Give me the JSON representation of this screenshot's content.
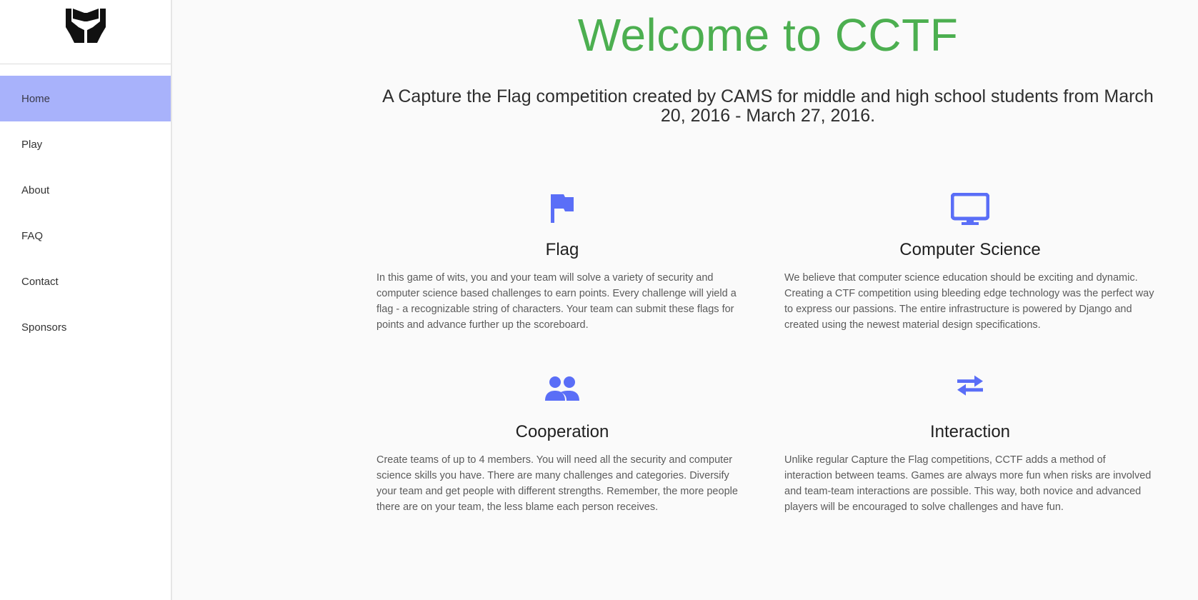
{
  "sidebar": {
    "logo_icon": "hands-holding-icon",
    "items": [
      {
        "label": "Home",
        "active": true
      },
      {
        "label": "Play",
        "active": false
      },
      {
        "label": "About",
        "active": false
      },
      {
        "label": "FAQ",
        "active": false
      },
      {
        "label": "Contact",
        "active": false
      },
      {
        "label": "Sponsors",
        "active": false
      }
    ]
  },
  "main": {
    "title": "Welcome to CCTF",
    "subtitle": "A Capture the Flag competition created by CAMS for middle and high school students from March 20, 2016 - March 27, 2016.",
    "features": [
      {
        "icon": "flag-icon",
        "title": "Flag",
        "text": "In this game of wits, you and your team will solve a variety of security and computer science based challenges to earn points. Every challenge will yield a flag - a recognizable string of characters. Your team can submit these flags for points and advance further up the scoreboard."
      },
      {
        "icon": "monitor-icon",
        "title": "Computer Science",
        "text": "We believe that computer science education should be exciting and dynamic. Creating a CTF competition using bleeding edge technology was the perfect way to express our passions. The entire infrastructure is powered by Django and created using the newest material design specifications."
      },
      {
        "icon": "people-icon",
        "title": "Cooperation",
        "text": "Create teams of up to 4 members. You will need all the security and computer science skills you have. There are many challenges and categories. Diversify your team and get people with different strengths. Remember, the more people there are on your team, the less blame each person receives."
      },
      {
        "icon": "swap-arrows-icon",
        "title": "Interaction",
        "text": "Unlike regular Capture the Flag competitions, CCTF adds a method of interaction between teams. Games are always more fun when risks are involved and team-team interactions are possible. This way, both novice and advanced players will be encouraged to solve challenges and have fun."
      }
    ]
  },
  "colors": {
    "title": "#4caf50",
    "accent_icon": "#5a6ef7",
    "active_nav": "#a8b2fb"
  }
}
